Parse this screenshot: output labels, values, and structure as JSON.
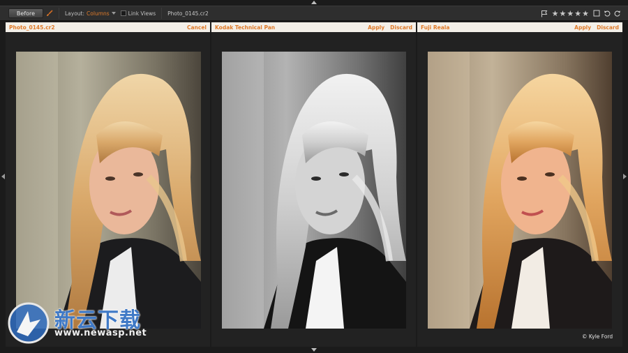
{
  "toolbar": {
    "before_label": "Before",
    "layout_label": "Layout:",
    "layout_value": "Columns",
    "link_views_label": "Link Views",
    "filename": "Photo_0145.cr2",
    "rating_stars": 5
  },
  "panes": [
    {
      "title": "Photo_0145.cr2",
      "actions": [
        "Cancel"
      ],
      "style": "color"
    },
    {
      "title": "Kodak Technical Pan",
      "actions": [
        "Apply",
        "Discard"
      ],
      "style": "bw"
    },
    {
      "title": "Fuji Reala",
      "actions": [
        "Apply",
        "Discard"
      ],
      "style": "warm"
    }
  ],
  "credit": "© Kyle Ford",
  "watermark": {
    "chinese": "新云下载",
    "url": "www.newasp.net"
  },
  "colors": {
    "accent": "#e07b2a",
    "header_bg": "#f3efe8",
    "watermark_blue": "#3f79c6"
  }
}
